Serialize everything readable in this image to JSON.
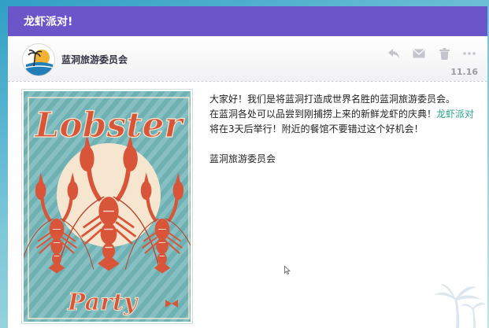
{
  "window": {
    "title": "龙虾派对!"
  },
  "sender": {
    "name": "蓝洞旅游委员会",
    "date": "11.16"
  },
  "toolbar": {
    "icons": [
      "reply-icon",
      "mail-icon",
      "trash-icon",
      "more-icon"
    ]
  },
  "poster": {
    "title_word": "Lobster",
    "subtitle_word": "Party"
  },
  "message": {
    "line1": "大家好！我们是将蓝洞打造成世界名胜的蓝洞旅游委员会。",
    "line2_before": "在蓝洞各处可以品尝到刚捕捞上来的新鲜龙虾的庆典！",
    "line2_link": "龙虾派对",
    "line2_after": "将在3天后举行！附近的餐馆不要错过这个好机会！",
    "signature": "蓝洞旅游委员会"
  },
  "colors": {
    "title_bar": "#6a56c9",
    "link": "#2aa58a",
    "poster_bg": "#7db8bc",
    "lobster": "#d9553a"
  }
}
